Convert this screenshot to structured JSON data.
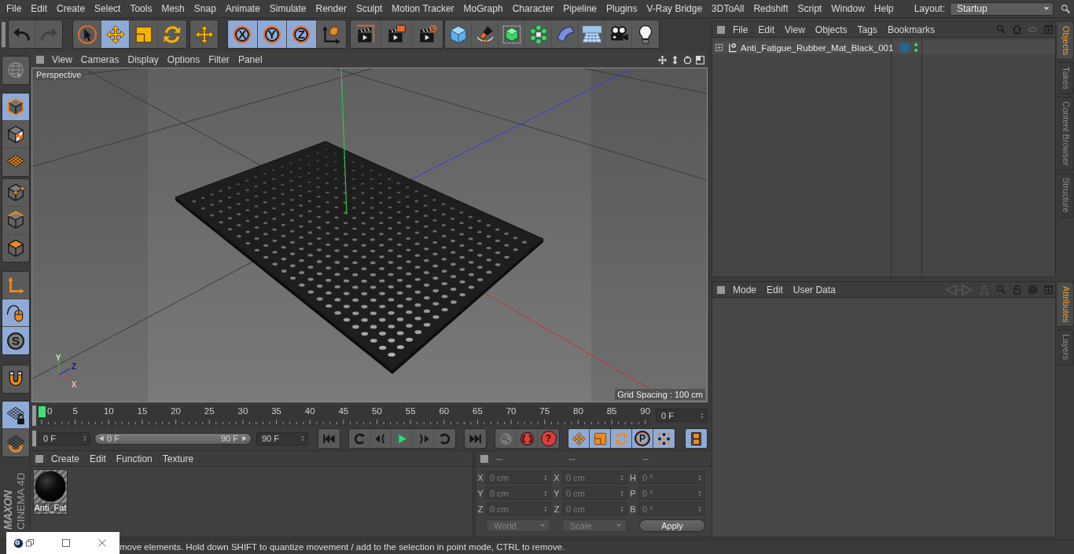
{
  "menu_bar": {
    "items": [
      "File",
      "Edit",
      "Create",
      "Select",
      "Tools",
      "Mesh",
      "Snap",
      "Animate",
      "Simulate",
      "Render",
      "Sculpt",
      "Motion Tracker",
      "MoGraph",
      "Character",
      "Pipeline",
      "Plugins",
      "V-Ray Bridge",
      "3DToAll",
      "Redshift",
      "Script",
      "Window",
      "Help"
    ],
    "layout_label": "Layout:",
    "layout_value": "Startup"
  },
  "history": [
    {
      "kind": "undo",
      "disabled": false
    },
    {
      "kind": "redo",
      "disabled": true
    }
  ],
  "toolbar_groups": [
    [
      {
        "kind": "live_select",
        "selected": false
      },
      {
        "kind": "move",
        "selected": true
      },
      {
        "kind": "scale",
        "selected": false
      },
      {
        "kind": "rotate",
        "selected": false
      }
    ],
    [
      {
        "kind": "transform",
        "selected": false
      }
    ],
    [
      {
        "kind": "axis_lock",
        "label": "X",
        "selected": true
      },
      {
        "kind": "axis_lock",
        "label": "Y",
        "selected": true
      },
      {
        "kind": "axis_lock",
        "label": "Z",
        "selected": true
      },
      {
        "kind": "coord_system",
        "selected": false
      }
    ],
    [
      {
        "kind": "render_view",
        "selected": false
      },
      {
        "kind": "render_pv",
        "selected": false
      },
      {
        "kind": "render_settings",
        "selected": false
      }
    ],
    [
      {
        "kind": "cube",
        "selected": false
      },
      {
        "kind": "pen",
        "selected": false
      },
      {
        "kind": "subdivision",
        "selected": false
      },
      {
        "kind": "cloner",
        "selected": false
      },
      {
        "kind": "deformer",
        "selected": false
      },
      {
        "kind": "floor",
        "selected": false
      },
      {
        "kind": "camera",
        "selected": false
      },
      {
        "kind": "light",
        "selected": false
      }
    ]
  ],
  "left_toolbar": [
    [
      {
        "kind": "globe",
        "selected": false
      }
    ],
    [
      {
        "kind": "model",
        "selected": true
      },
      {
        "kind": "texture",
        "selected": false
      },
      {
        "kind": "workplane",
        "selected": false
      }
    ],
    [
      {
        "kind": "points",
        "selected": false
      },
      {
        "kind": "edges",
        "selected": false
      },
      {
        "kind": "polygons",
        "selected": false
      }
    ],
    [
      {
        "kind": "axis",
        "selected": false
      },
      {
        "kind": "tweak",
        "selected": true
      },
      {
        "kind": "snap",
        "label": "S",
        "selected": true
      }
    ],
    [
      {
        "kind": "magnet",
        "selected": false
      }
    ],
    [
      {
        "kind": "grid_lock",
        "selected": true
      },
      {
        "kind": "grid_rotate",
        "selected": false
      }
    ]
  ],
  "logo": {
    "brand": "MAXON",
    "product": "CINEMA 4D"
  },
  "viewport": {
    "menu": [
      "View",
      "Cameras",
      "Display",
      "Options",
      "Filter",
      "Panel"
    ],
    "camera": "Perspective",
    "grid_spacing": "Grid Spacing : 100 cm",
    "gizmo": {
      "y": "Y",
      "z": "Z",
      "x": "X"
    }
  },
  "timeline": {
    "ticks": [
      "0",
      "5",
      "10",
      "15",
      "20",
      "25",
      "30",
      "35",
      "40",
      "45",
      "50",
      "55",
      "60",
      "65",
      "70",
      "75",
      "80",
      "85",
      "90"
    ],
    "current_frame": "0 F"
  },
  "playback": {
    "start": "0 F",
    "range": {
      "start": "0 F",
      "end": "90 F",
      "level": 1
    },
    "end": "90 F",
    "groups": [
      [
        {
          "kind": "go_start",
          "selected": false
        }
      ],
      [
        {
          "kind": "prev_key",
          "selected": false
        },
        {
          "kind": "prev_frame",
          "selected": false
        },
        {
          "kind": "play",
          "selected": false
        },
        {
          "kind": "next_frame",
          "selected": false
        },
        {
          "kind": "next_key",
          "selected": false
        }
      ],
      [
        {
          "kind": "go_end",
          "selected": false
        }
      ],
      [
        {
          "kind": "record",
          "selected": false
        },
        {
          "kind": "autokey",
          "selected": false
        },
        {
          "kind": "key_help",
          "label": "?",
          "selected": false
        }
      ],
      [
        {
          "kind": "key_move",
          "selected": true
        },
        {
          "kind": "key_scale",
          "selected": true
        },
        {
          "kind": "key_rotate",
          "selected": true
        },
        {
          "kind": "key_param",
          "label": "P",
          "selected": true
        },
        {
          "kind": "key_pla",
          "selected": true
        }
      ],
      [
        {
          "kind": "timeline_window",
          "selected": true
        }
      ]
    ]
  },
  "material_manager": {
    "menu": [
      "Create",
      "Edit",
      "Function",
      "Texture"
    ],
    "materials": [
      {
        "name": "Anti_Fat"
      }
    ]
  },
  "coordinates": {
    "headers": [
      "--",
      "--",
      "--"
    ],
    "rows": [
      [
        {
          "label": "X",
          "value": "0 cm"
        },
        {
          "label": "X",
          "value": "0 cm"
        },
        {
          "label": "H",
          "value": "0 °"
        }
      ],
      [
        {
          "label": "Y",
          "value": "0 cm"
        },
        {
          "label": "Y",
          "value": "0 cm"
        },
        {
          "label": "P",
          "value": "0 °"
        }
      ],
      [
        {
          "label": "Z",
          "value": "0 cm"
        },
        {
          "label": "Z",
          "value": "0 cm"
        },
        {
          "label": "B",
          "value": "0 °"
        }
      ]
    ],
    "mode": "World",
    "size_mode": "Scale",
    "apply": "Apply"
  },
  "object_manager": {
    "menu": [
      "File",
      "Edit",
      "View",
      "Objects",
      "Tags",
      "Bookmarks"
    ],
    "objects": [
      {
        "name": "Anti_Fatigue_Rubber_Mat_Black_001",
        "expanded": false,
        "color": "#1c6a9e",
        "editor_visible": true,
        "render_visible": true
      }
    ]
  },
  "attribute_manager": {
    "menu": [
      "Mode",
      "Edit",
      "User Data"
    ]
  },
  "side_tabs_top": [
    {
      "label": "Objects",
      "selected": true
    },
    {
      "label": "Takes",
      "selected": false
    },
    {
      "label": "Content Browser",
      "selected": false
    },
    {
      "label": "Structure",
      "selected": false
    }
  ],
  "side_tabs_bottom": [
    {
      "label": "Attributes",
      "selected": true
    },
    {
      "label": "Layers",
      "selected": false
    }
  ],
  "status_bar": {
    "text": "move elements. Hold down SHIFT to quantize movement / add to the selection in point mode, CTRL to remove."
  }
}
